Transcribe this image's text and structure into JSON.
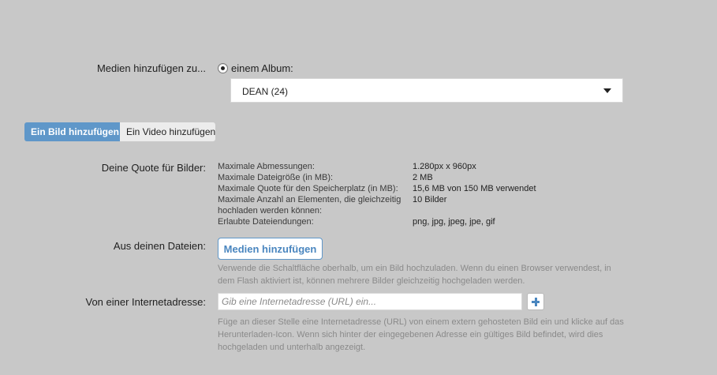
{
  "media": {
    "label": "Medien hinzufügen zu...",
    "radio_label": "einem Album:",
    "album_selected": "DEAN (24)"
  },
  "tabs": [
    {
      "label": "Ein Bild hinzufügen",
      "active": true
    },
    {
      "label": "Ein Video hinzufügen",
      "active": false
    }
  ],
  "quota": {
    "label": "Deine Quote für Bilder:",
    "rows": [
      {
        "key": "Maximale Abmessungen:",
        "value": "1.280px x 960px"
      },
      {
        "key": "Maximale Dateigröße (in MB):",
        "value": "2 MB"
      },
      {
        "key": "Maximale Quote für den Speicherplatz (in MB):",
        "value": "15,6 MB von 150 MB verwendet"
      },
      {
        "key": "Maximale Anzahl an Elementen, die gleichzeitig hochladen werden können:",
        "value": "10 Bilder"
      },
      {
        "key": "Erlaubte Dateiendungen:",
        "value": "png, jpg, jpeg, jpe, gif"
      }
    ]
  },
  "files": {
    "label": "Aus deinen Dateien:",
    "button": "Medien hinzufügen",
    "hint": "Verwende die Schaltfläche oberhalb, um ein Bild hochzuladen. Wenn du einen Browser verwendest, in dem Flash aktiviert ist, können mehrere Bilder gleichzeitig hochgeladen werden."
  },
  "url": {
    "label": "Von einer Internetadresse:",
    "placeholder": "Gib eine Internetadresse (URL) ein...",
    "value": "",
    "hint": "Füge an dieser Stelle eine Internetadresse (URL) von einem extern gehosteten Bild ein und klicke auf das Herunterladen-Icon. Wenn sich hinter der eingegebenen Adresse ein gültiges Bild befindet, wird dies hochgeladen und unterhalb angezeigt."
  },
  "colors": {
    "accent": "#5f97c9",
    "background": "#c8c8c8",
    "hint": "#8a8a8a"
  }
}
